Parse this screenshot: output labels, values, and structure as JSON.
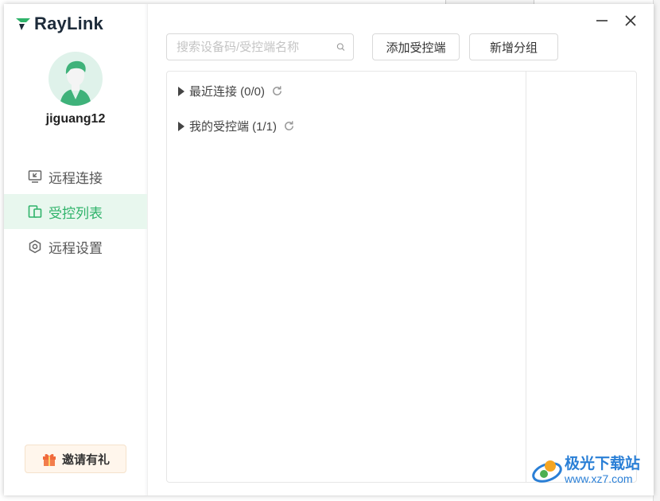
{
  "app": {
    "name": "RayLink",
    "username": "jiguang12"
  },
  "sidebar": {
    "items": [
      {
        "label": "远程连接",
        "icon": "remote-connect-icon"
      },
      {
        "label": "受控列表",
        "icon": "controlled-list-icon"
      },
      {
        "label": "远程设置",
        "icon": "remote-settings-icon"
      }
    ],
    "invite_label": "邀请有礼"
  },
  "toolbar": {
    "search_placeholder": "搜索设备码/受控端名称",
    "add_label": "添加受控端",
    "group_label": "新增分组"
  },
  "groups": [
    {
      "label": "最近连接 (0/0)"
    },
    {
      "label": "我的受控端 (1/1)"
    }
  ],
  "watermark": {
    "title": "极光下载站",
    "url": "www.xz7.com"
  },
  "colors": {
    "accent": "#2fb36a",
    "active_bg": "#e8f7ee"
  }
}
